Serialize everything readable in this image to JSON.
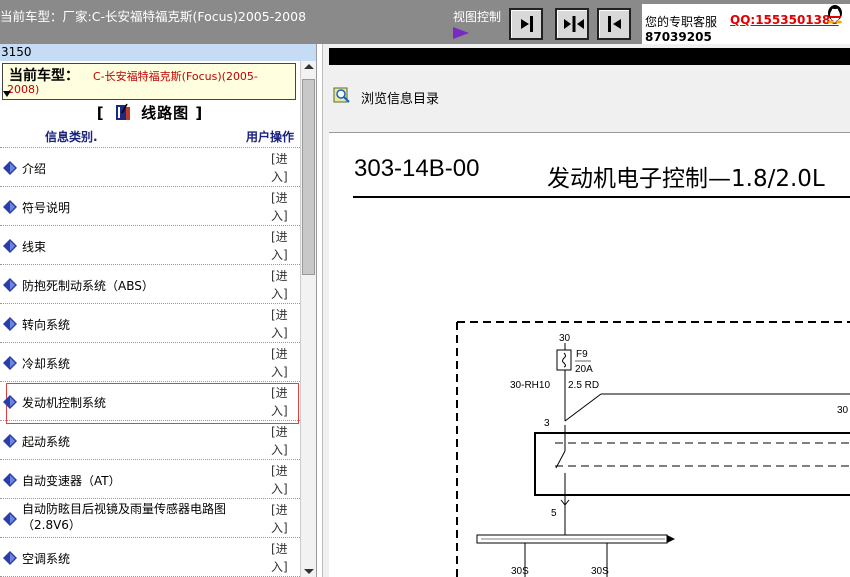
{
  "header": {
    "car_title": "当前车型：厂家:C-长安福特福克斯(Focus)2005-2008",
    "view_control_label": "视图控制",
    "service_label": "您的专职客服",
    "service_qq": "QQ:1553501388",
    "service_number": "87039205"
  },
  "sidebar": {
    "code": "3150",
    "model_label": "当前车型：",
    "model_value_line1": "C-长安福特福克斯(Focus)(2005-",
    "model_value_line2": "2008)",
    "section_title_left": "[",
    "section_title": "线路图",
    "section_title_right": "]",
    "col_category": "信息类别.",
    "col_action": "用户操作",
    "enter_line1": "[进",
    "enter_line2": "入]",
    "items": [
      {
        "label": "介绍"
      },
      {
        "label": "符号说明"
      },
      {
        "label": "线束"
      },
      {
        "label": "防抱死制动系统（ABS）"
      },
      {
        "label": "转向系统"
      },
      {
        "label": "冷却系统"
      },
      {
        "label": "发动机控制系统"
      },
      {
        "label": "起动系统"
      },
      {
        "label": "自动变速器（AT）"
      },
      {
        "label": "自动防眩目后视镜及雨量传感器电路图（2.8V6）"
      },
      {
        "label": "空调系统"
      }
    ],
    "selected_index": 6
  },
  "content": {
    "toolbar_label": "浏览信息目录",
    "doc_code": "303-14B-00",
    "doc_title": "发动机电子控制—1.8/2.0L",
    "diagram_labels": {
      "pin30_top": "30",
      "fuse": "F9",
      "fuse_rating": "20A",
      "wire_id": "30-RH10",
      "wire_spec": "2.5 RD",
      "pin3": "3",
      "pin30_right": "30",
      "pin5": "5",
      "bus1": "30S",
      "bus2": "30S"
    }
  },
  "icons": {
    "view_buttons": [
      "arrow-right-icon",
      "split-arrows-icon",
      "arrow-left-icon"
    ],
    "row_icon": "diamond-icon",
    "toolbar_icon": "magnifier-book-icon"
  },
  "colors": {
    "topbar": "#8a8a8a",
    "accent_red": "#e00000",
    "model_bg": "#ffffe0",
    "code_bar": "#c6dcf5",
    "category_header": "#1a237e",
    "diamond": "#2a3ea8"
  }
}
